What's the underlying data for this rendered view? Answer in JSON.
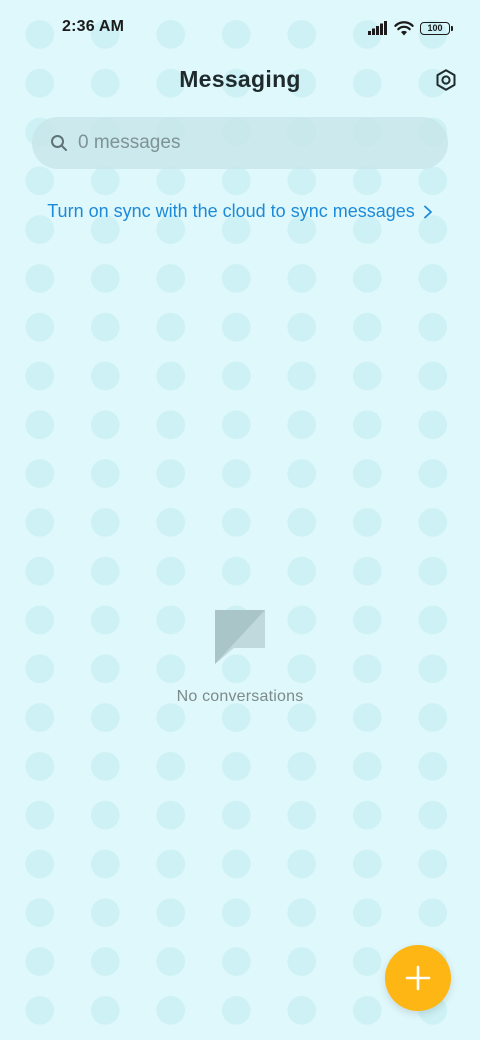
{
  "status_bar": {
    "time": "2:36 AM",
    "battery_level": "100",
    "icons": [
      "signal-icon",
      "wifi-icon",
      "battery-icon"
    ]
  },
  "header": {
    "title": "Messaging",
    "settings_icon": "gear-icon"
  },
  "search": {
    "placeholder": "0 messages",
    "icon": "search-icon"
  },
  "sync_banner": {
    "text": "Turn on sync with the cloud to sync messages",
    "icon": "chevron-right-icon"
  },
  "empty_state": {
    "icon": "message-bubble-icon",
    "text": "No conversations"
  },
  "fab": {
    "icon": "plus-icon"
  },
  "colors": {
    "background": "#dff8fb",
    "accent_link": "#1d8ad9",
    "fab": "#fdb614",
    "title": "#1f2a2d"
  }
}
